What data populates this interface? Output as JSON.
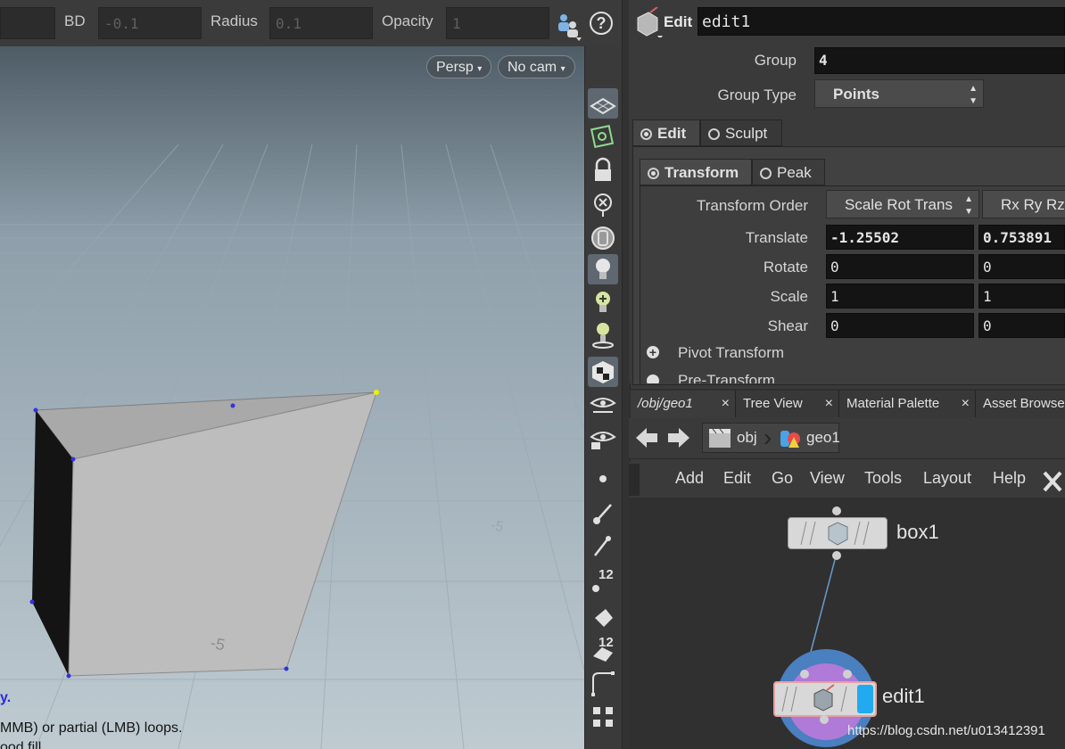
{
  "viewport_toolbar": {
    "bd_label": "BD",
    "bd_value": "-0.1",
    "radius_label": "Radius",
    "radius_value": "0.1",
    "opacity_label": "Opacity",
    "opacity_value": "1",
    "help_glyph": "?"
  },
  "viewport": {
    "persp_label": "Persp",
    "cam_label": "No cam",
    "hud_line1": "y.",
    "hud_line2": "MMB) or partial (LMB) loops.",
    "hud_line3": "ood fill.",
    "floor_label_a": "-5",
    "floor_label_b": "-5",
    "accent_color": "#4a4aff"
  },
  "shelf": {
    "badge_a": "12",
    "badge_b": "12"
  },
  "params": {
    "node_type": "Edit",
    "node_name": "edit1",
    "group_label": "Group",
    "group_value": "4",
    "group_type_label": "Group Type",
    "group_type_value": "Points",
    "tab_edit": "Edit",
    "tab_sculpt": "Sculpt",
    "tab_transform": "Transform",
    "tab_peak": "Peak",
    "transform_order_label": "Transform Order",
    "transform_order_value": "Scale Rot Trans",
    "rot_order_value": "Rx Ry Rz",
    "translate_label": "Translate",
    "translate_x": "-1.25502",
    "translate_y": "0.753891",
    "rotate_label": "Rotate",
    "rotate_x": "0",
    "rotate_y": "0",
    "scale_label": "Scale",
    "scale_x": "1",
    "scale_y": "1",
    "shear_label": "Shear",
    "shear_x": "0",
    "shear_y": "0",
    "pivot_label": "Pivot Transform",
    "pre_label": "Pre-Transform"
  },
  "network": {
    "tabs": [
      "/obj/geo1",
      "Tree View",
      "Material Palette",
      "Asset Browser"
    ],
    "close_glyph": "×",
    "path_obj": "obj",
    "path_geo": "geo1",
    "menu": [
      "Add",
      "Edit",
      "Go",
      "View",
      "Tools",
      "Layout",
      "Help"
    ],
    "node_box": "box1",
    "node_edit": "edit1",
    "watermark": "https://blog.csdn.net/u013412391"
  }
}
